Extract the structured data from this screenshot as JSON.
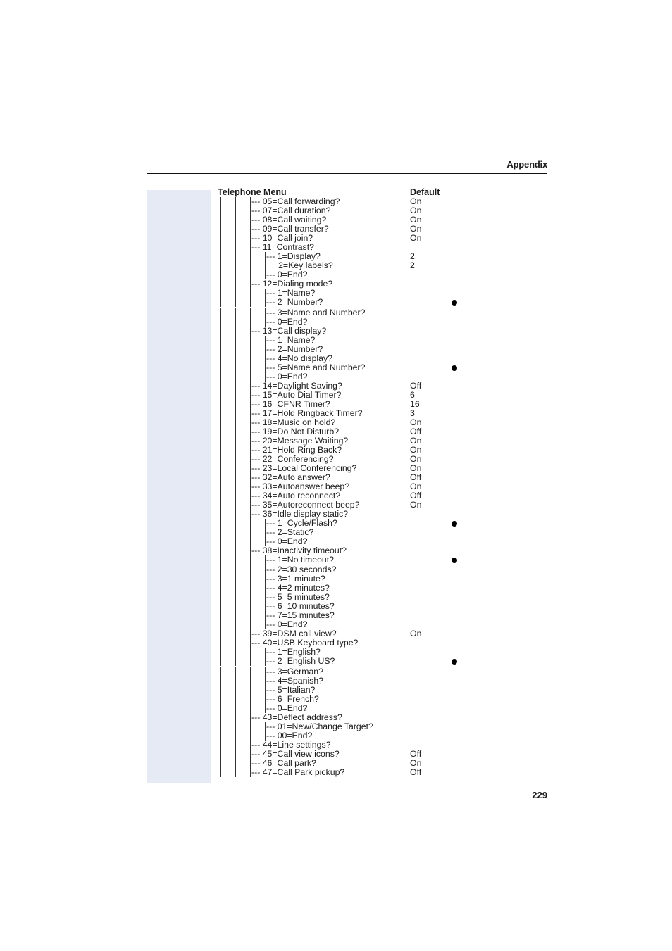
{
  "header": {
    "section_title": "Appendix"
  },
  "table": {
    "menu_column_header": "Telephone Menu",
    "default_column_header": "Default",
    "rows": [
      {
        "level": 1,
        "prefix": "|--- ",
        "label": "05=Call forwarding?",
        "default": "On"
      },
      {
        "level": 1,
        "prefix": "--- ",
        "label": "07=Call duration?",
        "default": "On"
      },
      {
        "level": 1,
        "prefix": "--- ",
        "label": "08=Call waiting?",
        "default": "On"
      },
      {
        "level": 1,
        "prefix": "--- ",
        "label": "09=Call transfer?",
        "default": "On"
      },
      {
        "level": 1,
        "prefix": "--- ",
        "label": "10=Call join?",
        "default": "On"
      },
      {
        "level": 1,
        "prefix": "--- ",
        "label": "11=Contrast?",
        "default": ""
      },
      {
        "level": 2,
        "prefix": "|--- ",
        "label": "1=Display?",
        "default": "2"
      },
      {
        "level": 2,
        "prefix": "     ",
        "label": "2=Key labels?",
        "default": "2"
      },
      {
        "level": 2,
        "prefix": "|--- ",
        "label": "0=End?",
        "default": ""
      },
      {
        "level": 1,
        "prefix": "--- ",
        "label": "12=Dialing mode?",
        "default": ""
      },
      {
        "level": 2,
        "prefix": "|--- ",
        "label": "1=Name?",
        "default": ""
      },
      {
        "level": 2,
        "prefix": "|--- ",
        "label": "2=Number?",
        "default": "",
        "marked": true
      },
      {
        "level": 2,
        "prefix": "|--- ",
        "label": "3=Name and Number?",
        "default": ""
      },
      {
        "level": 2,
        "prefix": "|--- ",
        "label": "0=End?",
        "default": ""
      },
      {
        "level": 1,
        "prefix": "--- ",
        "label": "13=Call display?",
        "default": ""
      },
      {
        "level": 2,
        "prefix": "|--- ",
        "label": "1=Name?",
        "default": ""
      },
      {
        "level": 2,
        "prefix": "|--- ",
        "label": "2=Number?",
        "default": ""
      },
      {
        "level": 2,
        "prefix": "|--- ",
        "label": "4=No display?",
        "default": ""
      },
      {
        "level": 2,
        "prefix": "|--- ",
        "label": "5=Name and Number?",
        "default": "",
        "marked": true
      },
      {
        "level": 2,
        "prefix": "|--- ",
        "label": "0=End?",
        "default": ""
      },
      {
        "level": 1,
        "prefix": "--- ",
        "label": "14=Daylight Saving?",
        "default": "Off"
      },
      {
        "level": 1,
        "prefix": "--- ",
        "label": "15=Auto Dial Timer?",
        "default": "6"
      },
      {
        "level": 1,
        "prefix": "--- ",
        "label": "16=CFNR Timer?",
        "default": "16"
      },
      {
        "level": 1,
        "prefix": "--- ",
        "label": "17=Hold Ringback Timer?",
        "default": "3"
      },
      {
        "level": 1,
        "prefix": "--- ",
        "label": "18=Music on hold?",
        "default": "On"
      },
      {
        "level": 1,
        "prefix": "--- ",
        "label": "19=Do Not Disturb?",
        "default": "Off"
      },
      {
        "level": 1,
        "prefix": "--- ",
        "label": "20=Message Waiting?",
        "default": "On"
      },
      {
        "level": 1,
        "prefix": "--- ",
        "label": "21=Hold Ring Back?",
        "default": "On"
      },
      {
        "level": 1,
        "prefix": "--- ",
        "label": "22=Conferencing?",
        "default": "On"
      },
      {
        "level": 1,
        "prefix": "--- ",
        "label": "23=Local Conferencing?",
        "default": "On"
      },
      {
        "level": 1,
        "prefix": "--- ",
        "label": "32=Auto answer?",
        "default": "Off"
      },
      {
        "level": 1,
        "prefix": "--- ",
        "label": "33=Autoanswer beep?",
        "default": "On"
      },
      {
        "level": 1,
        "prefix": "--- ",
        "label": "34=Auto reconnect?",
        "default": "Off"
      },
      {
        "level": 1,
        "prefix": "--- ",
        "label": "35=Autoreconnect beep?",
        "default": "On"
      },
      {
        "level": 1,
        "prefix": "--- ",
        "label": "36=Idle display static?",
        "default": ""
      },
      {
        "level": 2,
        "prefix": "|--- ",
        "label": "1=Cycle/Flash?",
        "default": "",
        "marked": true
      },
      {
        "level": 2,
        "prefix": "|--- ",
        "label": "2=Static?",
        "default": ""
      },
      {
        "level": 2,
        "prefix": "|--- ",
        "label": "0=End?",
        "default": ""
      },
      {
        "level": 1,
        "prefix": "--- ",
        "label": "38=Inactivity timeout?",
        "default": ""
      },
      {
        "level": 2,
        "prefix": "|--- ",
        "label": "1=No timeout?",
        "default": "",
        "marked": true
      },
      {
        "level": 2,
        "prefix": "|--- ",
        "label": "2=30 seconds?",
        "default": ""
      },
      {
        "level": 2,
        "prefix": "|--- ",
        "label": "3=1 minute?",
        "default": ""
      },
      {
        "level": 2,
        "prefix": "|--- ",
        "label": "4=2 minutes?",
        "default": ""
      },
      {
        "level": 2,
        "prefix": "|--- ",
        "label": "5=5 minutes?",
        "default": ""
      },
      {
        "level": 2,
        "prefix": "|--- ",
        "label": "6=10 minutes?",
        "default": ""
      },
      {
        "level": 2,
        "prefix": "|--- ",
        "label": "7=15 minutes?",
        "default": ""
      },
      {
        "level": 2,
        "prefix": "|--- ",
        "label": "0=End?",
        "default": ""
      },
      {
        "level": 1,
        "prefix": "--- ",
        "label": "39=DSM call view?",
        "default": "On"
      },
      {
        "level": 1,
        "prefix": "--- ",
        "label": "40=USB Keyboard type?",
        "default": ""
      },
      {
        "level": 2,
        "prefix": "|--- ",
        "label": "1=English?",
        "default": ""
      },
      {
        "level": 2,
        "prefix": "|--- ",
        "label": "2=English US?",
        "default": "",
        "marked": true
      },
      {
        "level": 2,
        "prefix": "|--- ",
        "label": "3=German?",
        "default": ""
      },
      {
        "level": 2,
        "prefix": "|--- ",
        "label": "4=Spanish?",
        "default": ""
      },
      {
        "level": 2,
        "prefix": "|--- ",
        "label": "5=Italian?",
        "default": ""
      },
      {
        "level": 2,
        "prefix": "|--- ",
        "label": "6=French?",
        "default": ""
      },
      {
        "level": 2,
        "prefix": "|--- ",
        "label": "0=End?",
        "default": ""
      },
      {
        "level": 1,
        "prefix": "--- ",
        "label": "43=Deflect address?",
        "default": ""
      },
      {
        "level": 2,
        "prefix": "|--- ",
        "label": "01=New/Change Target?",
        "default": ""
      },
      {
        "level": 2,
        "prefix": "|--- ",
        "label": "00=End?",
        "default": ""
      },
      {
        "level": 1,
        "prefix": "--- ",
        "label": "44=Line settings?",
        "default": ""
      },
      {
        "level": 1,
        "prefix": "--- ",
        "label": "45=Call view icons?",
        "default": "Off"
      },
      {
        "level": 1,
        "prefix": "--- ",
        "label": "46=Call park?",
        "default": "On"
      },
      {
        "level": 1,
        "prefix": "|--- ",
        "label": "47=Call Park pickup?",
        "default": "Off"
      }
    ]
  },
  "footer": {
    "page_number": "229"
  }
}
